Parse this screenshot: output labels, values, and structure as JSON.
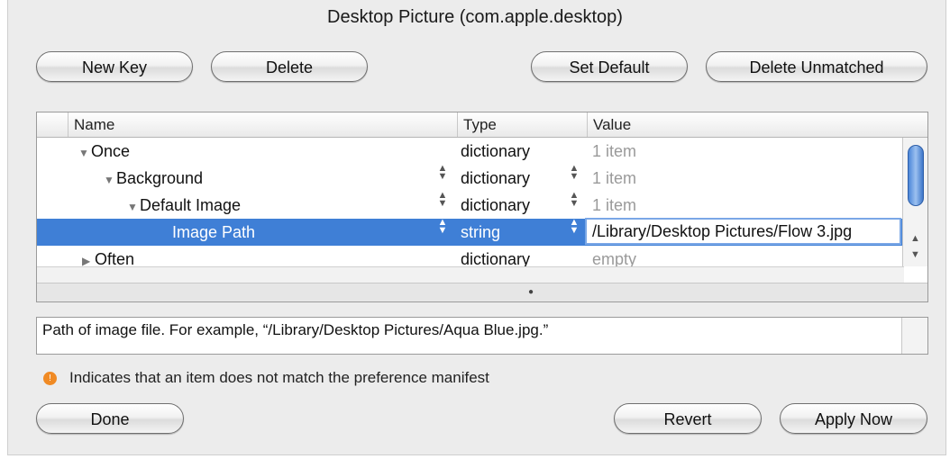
{
  "window": {
    "title": "Desktop Picture (com.apple.desktop)"
  },
  "toolbar": {
    "new_key": "New Key",
    "delete": "Delete",
    "set_default": "Set Default",
    "delete_unmatched": "Delete Unmatched"
  },
  "table": {
    "columns": [
      "Name",
      "Type",
      "Value"
    ],
    "rows": [
      {
        "name": "Once",
        "type": "dictionary",
        "value": "1 item"
      },
      {
        "name": "Background",
        "type": "dictionary",
        "value": "1 item"
      },
      {
        "name": "Default Image",
        "type": "dictionary",
        "value": "1 item"
      },
      {
        "name": "Image Path",
        "type": "string",
        "value": "/Library/Desktop Pictures/Flow 3.jpg"
      },
      {
        "name": "Often",
        "type": "dictionary",
        "value": "empty"
      }
    ]
  },
  "description": "Path of image file. For example, “/Library/Desktop Pictures/Aqua Blue.jpg.”",
  "note": "Indicates that an item does not match the preference manifest",
  "icons": {
    "warning": "warning-icon",
    "disclosure_open": "triangle-down-icon",
    "disclosure_closed": "triangle-right-icon",
    "stepper": "up-down-stepper-icon"
  },
  "colors": {
    "selection": "#3f7fd6",
    "warning": "#f08a24"
  },
  "footer": {
    "done": "Done",
    "revert": "Revert",
    "apply_now": "Apply Now"
  }
}
